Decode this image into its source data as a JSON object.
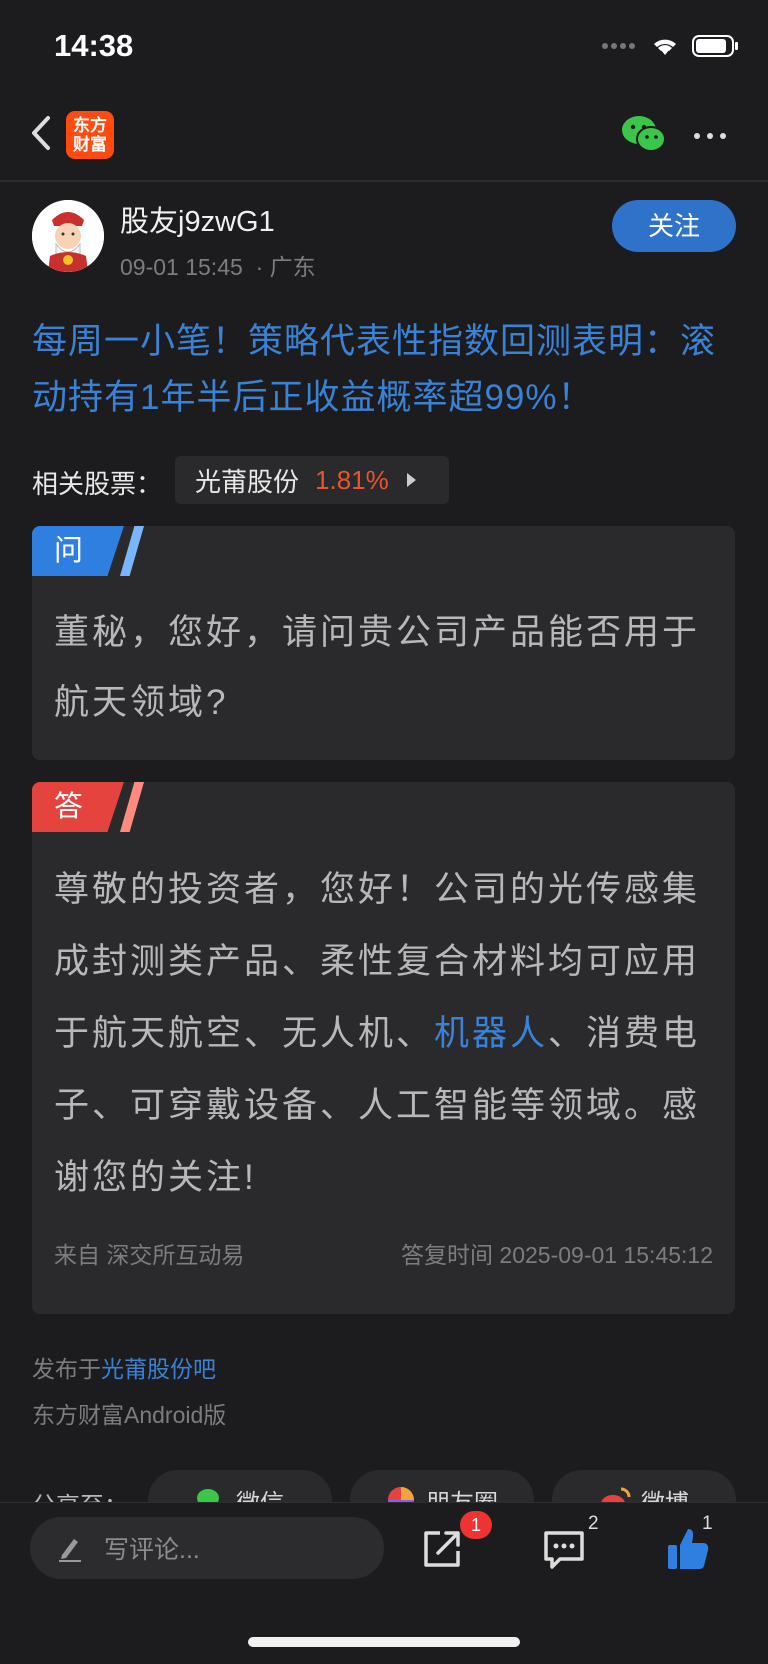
{
  "status_bar": {
    "time": "14:38"
  },
  "nav": {
    "logo_text_line1": "东方",
    "logo_text_line2": "财富"
  },
  "author": {
    "name": "股友j9zwG1",
    "date": "09-01 15:45",
    "location": "· 广东",
    "follow_label": "关注"
  },
  "post": {
    "title": "每周一小笔！策略代表性指数回测表明：滚动持有1年半后正收益概率超99%！"
  },
  "related": {
    "label": "相关股票：",
    "stock_name": "光莆股份",
    "stock_change": "1.81%"
  },
  "question": {
    "tag": "问",
    "text": "董秘，您好，请问贵公司产品能否用于航天领域?"
  },
  "answer": {
    "tag": "答",
    "text_before": "尊敬的投资者，您好！公司的光传感集成封测类产品、柔性复合材料均可应用于航天航空、无人机、",
    "keyword": "机器人",
    "text_after": "、消费电子、可穿戴设备、人工智能等领域。感谢您的关注!",
    "source": "来自 深交所互动易",
    "reply_time": "答复时间 2025-09-01 15:45:12"
  },
  "footer": {
    "publish_prefix": "发布于",
    "publish_link": "光莆股份吧",
    "client": "东方财富Android版"
  },
  "share": {
    "label": "分享至：",
    "wechat": "微信",
    "moments": "朋友圈",
    "weibo": "微博"
  },
  "bottom_bar": {
    "comment_placeholder": "写评论...",
    "share_badge": "1",
    "comment_count": "2",
    "like_count": "1"
  },
  "colors": {
    "accent_blue": "#3a82d6",
    "follow_blue": "#2f72c9",
    "rise_red": "#e8542f",
    "question_tag": "#2e7fe0",
    "answer_tag": "#e5433e",
    "brand_orange": "#ff4a10"
  }
}
